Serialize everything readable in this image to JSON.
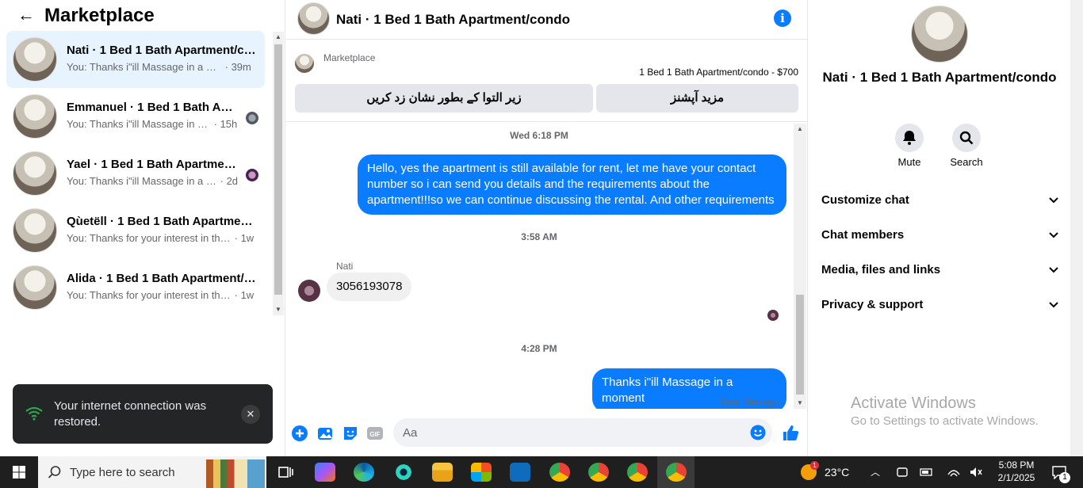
{
  "left": {
    "title": "Marketplace",
    "conversations": [
      {
        "name": "Nati · 1 Bed 1 Bath Apartment/condo",
        "snippet": "You: Thanks i\"ill Massage in a moment",
        "time": "· 39m",
        "active": true
      },
      {
        "name": "Emmanuel · 1 Bed 1 Bath Apartment/condo",
        "snippet": "You: Thanks i\"ill Massage in a moment",
        "time": "· 15h"
      },
      {
        "name": "Yael · 1 Bed 1 Bath Apartment/condo",
        "snippet": "You: Thanks i\"ill Massage in a moment",
        "time": "· 2d"
      },
      {
        "name": "Qùetëll · 1 Bed 1 Bath Apartment/condo",
        "snippet": "You: Thanks for your interest in the item",
        "time": "· 1w"
      },
      {
        "name": "Alida · 1 Bed 1 Bath Apartment/condo",
        "snippet": "You: Thanks for your interest in the item",
        "time": "· 1w"
      }
    ],
    "toast": {
      "message": "Your internet connection was restored.",
      "close": "✕"
    }
  },
  "chat": {
    "title": "Nati · 1 Bed 1 Bath Apartment/condo",
    "info_icon": "i",
    "marketplace_label": "Marketplace",
    "listing": "1 Bed 1 Bath Apartment/condo - $700",
    "btn_mark": "زیر التوا کے بطور نشان زد کریں",
    "btn_more": "مزید آپشنز",
    "messages": {
      "ts1": "Wed 6:18 PM",
      "out1": "Hello, yes the apartment is still available for rent, let me have your contact number so i can send you details and the requirements about the apartment!!!so we can continue discussing the rental. And other requirements",
      "ts2": "3:58 AM",
      "sender": "Nati",
      "in1": "3056193078",
      "ts3": "4:28 PM",
      "out2": "Thanks i\"ill Massage in a moment",
      "sent": "Sent 39m ago"
    },
    "composer_placeholder": "Aa"
  },
  "right": {
    "name": "Nati · 1 Bed 1 Bath Apartment/condo",
    "mute": "Mute",
    "search": "Search",
    "sections": [
      "Customize chat",
      "Chat members",
      "Media, files and links",
      "Privacy & support"
    ],
    "activate_title": "Activate Windows",
    "activate_sub": "Go to Settings to activate Windows."
  },
  "taskbar": {
    "search_placeholder": "Type here to search",
    "temp": "23°C",
    "time": "5:08 PM",
    "date": "2/1/2025",
    "notif_count": "1",
    "weather_badge": "1"
  },
  "colors": {
    "accent": "#0a7cff",
    "active_bg": "#e7f3ff"
  }
}
